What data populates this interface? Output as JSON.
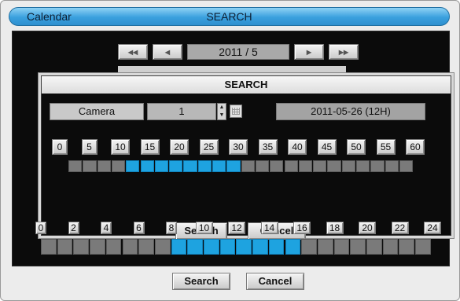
{
  "titlebar": {
    "left": "Calendar",
    "center": "SEARCH"
  },
  "nav": {
    "first_icon": "rewind-icon",
    "first_glyph": "◀◀",
    "prev_icon": "prev-icon",
    "prev_glyph": "◀",
    "year_month": "2011 / 5",
    "next_icon": "next-icon",
    "next_glyph": "▶",
    "last_icon": "fast-forward-icon",
    "last_glyph": "▶▶"
  },
  "dialog": {
    "title": "SEARCH",
    "camera_label": "Camera",
    "channel_value": "1",
    "date_value": "2011-05-26  (12H)",
    "minute_labels": [
      "0",
      "5",
      "10",
      "15",
      "20",
      "25",
      "30",
      "35",
      "40",
      "45",
      "50",
      "55",
      "60"
    ],
    "minute_segments": [
      0,
      0,
      0,
      0,
      1,
      1,
      1,
      1,
      1,
      1,
      1,
      1,
      0,
      0,
      0,
      0,
      0,
      0,
      0,
      0,
      0,
      0,
      0,
      0
    ],
    "search_label": "Search",
    "cancel_label": "Cancel"
  },
  "hour_labels": [
    "0",
    "2",
    "4",
    "6",
    "8",
    "10",
    "12",
    "14",
    "16",
    "18",
    "20",
    "22",
    "24"
  ],
  "hour_segments": [
    0,
    0,
    0,
    0,
    0,
    0,
    0,
    0,
    1,
    1,
    1,
    1,
    1,
    1,
    1,
    1,
    0,
    0,
    0,
    0,
    0,
    0,
    0,
    0
  ],
  "footer": {
    "search_label": "Search",
    "cancel_label": "Cancel"
  },
  "colors": {
    "recorded": "#1ea3e0",
    "empty": "#7a7a7a",
    "titlebar": "#3aa0de"
  }
}
